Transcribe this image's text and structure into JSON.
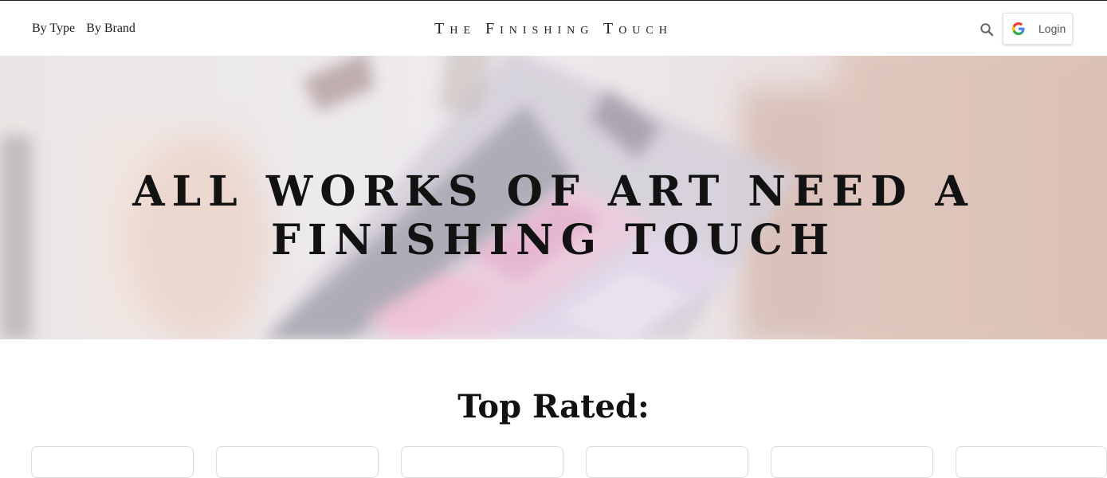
{
  "nav": {
    "links": [
      "By Type",
      "By Brand"
    ]
  },
  "header": {
    "site_title": "The Finishing Touch",
    "login_label": "Login"
  },
  "icons": {
    "search": "search-icon",
    "google": "google-icon"
  },
  "hero": {
    "headline": "All works of art need a finishing touch"
  },
  "section": {
    "heading": "Top Rated:"
  },
  "product_cards": [
    {},
    {},
    {},
    {},
    {},
    {}
  ],
  "colors": {
    "accent_pink": "#e7b6cf",
    "lavender": "#d9d3ea",
    "text_dark": "#111111"
  }
}
